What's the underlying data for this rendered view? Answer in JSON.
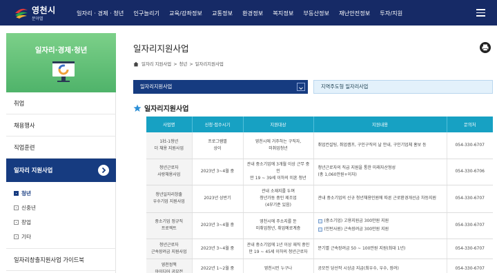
{
  "header": {
    "logo_name": "영천시",
    "logo_sub": "분야별",
    "menu": [
      "일자리 · 경제 · 청년",
      "인구늘리기",
      "교육/강좌정보",
      "교통정보",
      "환경정보",
      "복지정보",
      "부동산정보",
      "재난안전정보",
      "투자/지원"
    ]
  },
  "sidebar": {
    "title": "일자리·경제·청년",
    "items": [
      "취업",
      "채용행사",
      "직업훈련"
    ],
    "active_item": "일자리 지원사업",
    "sub_items": [
      "청년",
      "신중년",
      "창업",
      "기타"
    ],
    "bottom_item": "일자리창출지원사업 가이드북"
  },
  "main": {
    "title": "일자리지원사업",
    "breadcrumb": [
      "일자리 지원사업",
      "청년",
      "일자리지원사업"
    ],
    "tab_active": "일자리지원사업",
    "tab_other": "지역주도형 일자리사업",
    "section_title": "일자리지원사업"
  },
  "table": {
    "headers": [
      "사업명",
      "신청·접수시기",
      "지원대상",
      "지원내용",
      "문의처"
    ],
    "rows": [
      [
        "1社-1청년\n더 채용 지원사업",
        "프로그램별\n상이",
        "영천시에 거주하는 구직자,\n미취업청년",
        [
          "취업컨설팅, 취업캠프, 구인구직의 날 안내, 구인기업체 홍보 등"
        ],
        "054-330-6707"
      ],
      [
        "청년근로자\n사랑채용사업",
        "2023년 3~4월 중",
        "관내 중소기업에 3개월 이상 근무 중인\n만 19 ~ 39세 이하의 미혼 청년",
        [
          "청년근로자의 직급 지원을 통한 미래자산형성\n(총 1,060만원+이자)"
        ],
        "054-330-6706"
      ],
      [
        "청년일자리창출\n우수기업 지원사업",
        "2023년 상반기",
        "관내 소재지를 두며\n청년가동 중인 제조업\n(4부기준 있음)",
        [
          "관내 중소기업의 신규 청년채용인원에 따른 근로환경개선금 차등지원"
        ],
        "054-330-6707"
      ],
      [
        "중소기업 정규직\n프로젝트",
        "2023년 3~4월 중",
        "영천시에 주소지를 둔\n미취업청년, 취업예로계층",
        [
          "(중소기업) 고용지원금 300만원 지원",
          "(인턴사원) 근속장려금 300만원 지원"
        ],
        "054-330-6707"
      ],
      [
        "청년근로자\n근속장려금 지원사업",
        "2023년 3~4월 중",
        "관내 중소기업에 1년 이상 재직 중인\n만 19 ~ 45세 이하의 청년근로자",
        [
          "분기별 근속장려금 50 ~ 100만원 지원(최대 1년)"
        ],
        "054-330-6707"
      ],
      [
        "영천정책\n아이디어 공모전",
        "2022년 1~2월 중",
        "영천시민 누구나",
        [
          "공모전 당선작 시상금 지급(최우수, 우수, 장려)"
        ],
        "054-330-6707"
      ]
    ]
  },
  "colors": {
    "nav": "#162a66",
    "side_head": "#5bbd70",
    "active": "#163b80",
    "table_head": "#17a1c3"
  },
  "icons": {
    "home": "home-icon",
    "print": "print-icon",
    "star": "star-icon",
    "menu": "hamburger-icon"
  }
}
